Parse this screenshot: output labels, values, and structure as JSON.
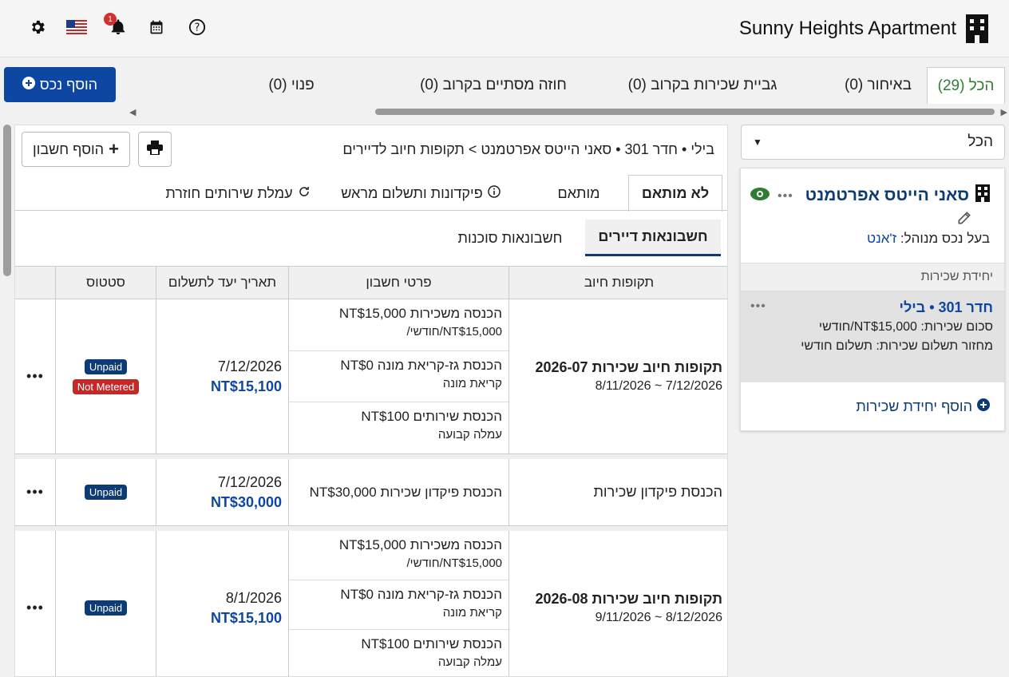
{
  "header": {
    "title": "Sunny Heights Apartment",
    "notification_count": "1",
    "icons": [
      "gear-icon",
      "us-flag-icon",
      "bell-icon",
      "calendar-icon",
      "help-icon",
      "building-icon"
    ]
  },
  "colors": {
    "primary": "#0d47a1",
    "dark_blue": "#0d3c74",
    "green": "#2e7d32",
    "red": "#c62828"
  },
  "top_tabs": [
    {
      "label": "הכל (29)",
      "active": true
    },
    {
      "label": "באיחור (0)"
    },
    {
      "label": "גביית שכירות בקרוב (0)"
    },
    {
      "label": "חוזה מסתיים בקרוב (0)"
    },
    {
      "label": "פנוי (0)"
    }
  ],
  "add_property_label": "הוסף נכס",
  "sidebar": {
    "filter_value": "הכל",
    "property_name": "סאני הייטס אפרטמנט",
    "owner_label": "בעל נכס מנוהל:",
    "owner_name": "ז'אנט",
    "units_header": "יחידת שכירות",
    "unit": {
      "name": "חדר 301 • בילי",
      "rent": "סכום שכירות: NT$15,000/חודשי",
      "cycle": "מחזור תשלום שכירות: תשלום חודשי"
    },
    "add_unit_label": "הוסף יחידת שכירות"
  },
  "main": {
    "breadcrumb": "בילי • חדר 301 • סאני הייטס אפרטמנט > תקופות חיוב לדיירים",
    "add_bill_label": "הוסף חשבון",
    "sub_tabs": [
      {
        "label": "לא מותאם",
        "active": true
      },
      {
        "label": "מותאם"
      },
      {
        "label": "פיקדונות ותשלום מראש"
      },
      {
        "label": "עמלת שירותים חוזרת"
      }
    ],
    "bill_tabs": [
      {
        "label": "חשבונאות דיירים",
        "active": true
      },
      {
        "label": "חשבונאות סוכנות"
      }
    ],
    "columns": [
      "תקופות חיוב",
      "פרטי חשבון",
      "תאריך יעד לתשלום",
      "סטטוס"
    ],
    "rows": [
      {
        "period_title": "תקופות חיוב שכירות 2026-07",
        "period_range": "7/12/2026 ~ 8/11/2026",
        "items": [
          {
            "main": "הכנסה משכירות NT$15,000",
            "sub": "NT$15,000/חודשי/"
          },
          {
            "main": "הכנסת גז-קריאת מונה NT$0",
            "sub": "קריאת מונה"
          },
          {
            "main": "הכנסת שירותים NT$100",
            "sub": "עמלה קבועה"
          }
        ],
        "due_date": "7/12/2026",
        "due_amount": "NT$15,100",
        "status": [
          "Unpaid",
          "Not Metered"
        ]
      },
      {
        "period_title": "הכנסת פיקדון שכירות",
        "period_range": "",
        "items": [
          {
            "main": "הכנסת פיקדון שכירות NT$30,000",
            "sub": ""
          }
        ],
        "due_date": "7/12/2026",
        "due_amount": "NT$30,000",
        "status": [
          "Unpaid"
        ]
      },
      {
        "period_title": "תקופות חיוב שכירות 2026-08",
        "period_range": "8/12/2026 ~ 9/11/2026",
        "items": [
          {
            "main": "הכנסה משכירות NT$15,000",
            "sub": "NT$15,000/חודשי/"
          },
          {
            "main": "הכנסת גז-קריאת מונה NT$0",
            "sub": "קריאת מונה"
          },
          {
            "main": "הכנסת שירותים NT$100",
            "sub": "עמלה קבועה"
          }
        ],
        "due_date": "8/1/2026",
        "due_amount": "NT$15,100",
        "status": [
          "Unpaid"
        ]
      }
    ]
  }
}
